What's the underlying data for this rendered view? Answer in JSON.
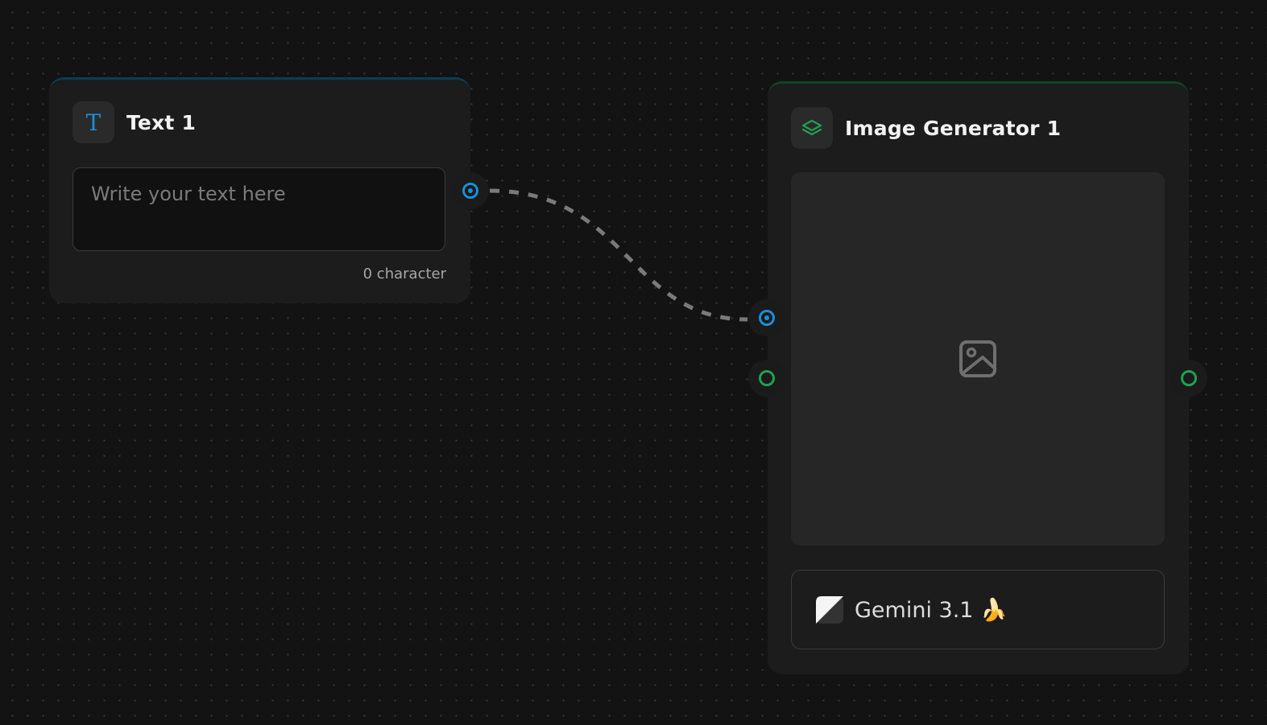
{
  "colors": {
    "background": "#131313",
    "node_bg": "#1c1c1c",
    "text_accent": "#1a8fd8",
    "image_accent": "#22a050",
    "edge": "#7a7a7a"
  },
  "text_node": {
    "title": "Text 1",
    "icon": "text-t-icon",
    "icon_glyph": "T",
    "placeholder": "Write your text here",
    "value": "",
    "char_count": "0 character"
  },
  "image_node": {
    "title": "Image Generator 1",
    "icon": "layers-icon",
    "preview_icon": "image-placeholder-icon",
    "model": {
      "label": "Gemini 3.1 🍌",
      "icon": "gemini-model-icon"
    }
  }
}
